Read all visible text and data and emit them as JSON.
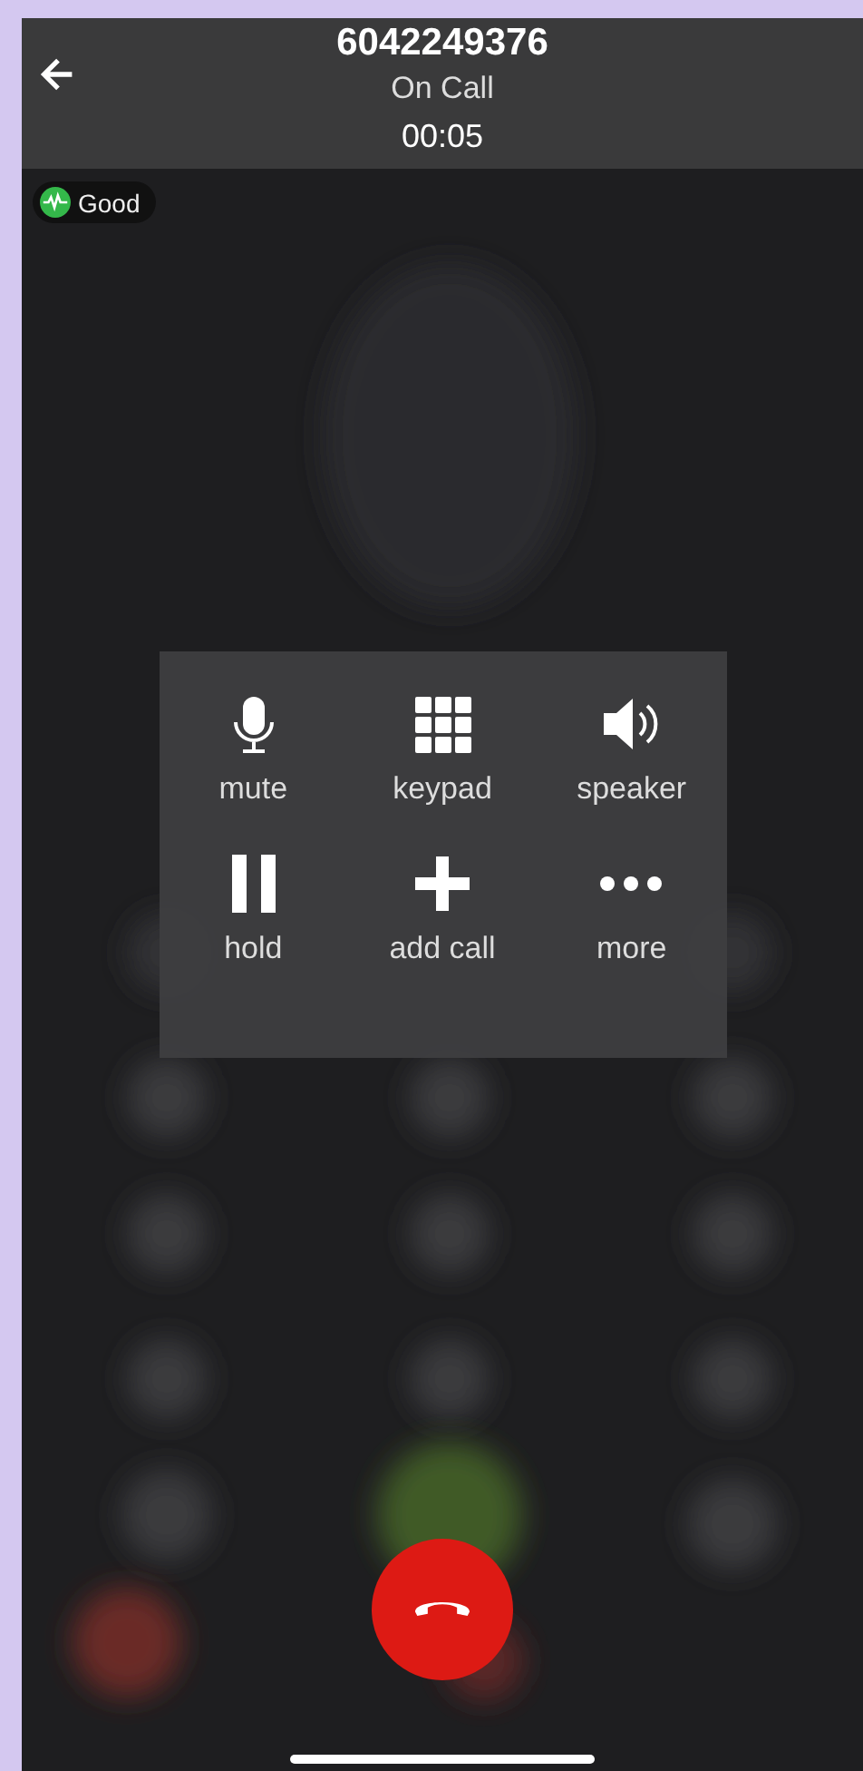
{
  "header": {
    "number": "6042249376",
    "status": "On Call",
    "timer": "00:05"
  },
  "quality": {
    "label": "Good",
    "color": "#34b84a"
  },
  "controls": [
    {
      "kind": "mic",
      "label": "mute"
    },
    {
      "kind": "keypad",
      "label": "keypad"
    },
    {
      "kind": "speaker",
      "label": "speaker"
    },
    {
      "kind": "pause",
      "label": "hold"
    },
    {
      "kind": "plus",
      "label": "add call"
    },
    {
      "kind": "dots",
      "label": "more"
    }
  ]
}
